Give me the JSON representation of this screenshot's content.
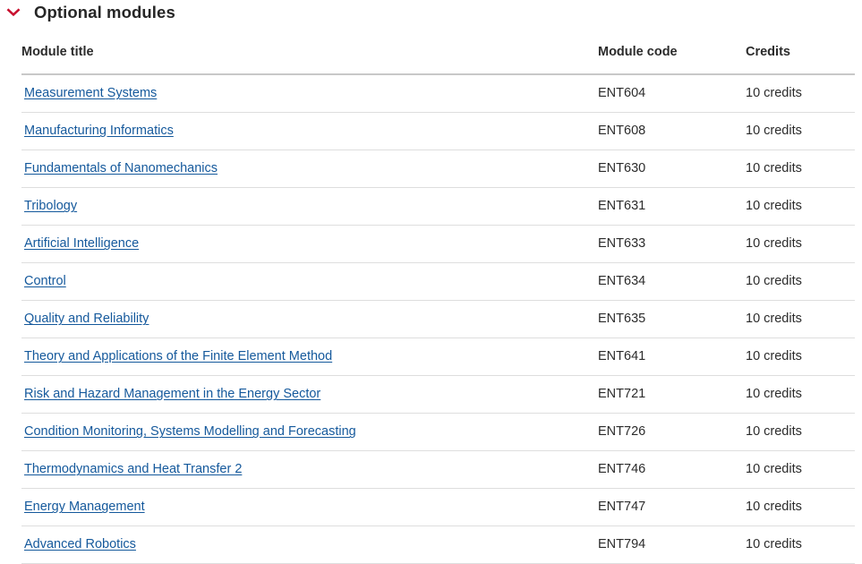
{
  "section": {
    "title": "Optional modules",
    "toggle_icon": "chevron-down-icon",
    "expanded": true,
    "accent_color": "#c8102e"
  },
  "table": {
    "columns": [
      {
        "key": "title",
        "label": "Module title"
      },
      {
        "key": "code",
        "label": "Module code"
      },
      {
        "key": "credits",
        "label": "Credits"
      }
    ],
    "link_color": "#15599c",
    "rows": [
      {
        "title": "Measurement Systems",
        "code": "ENT604",
        "credits": "10 credits"
      },
      {
        "title": "Manufacturing Informatics",
        "code": "ENT608",
        "credits": "10 credits"
      },
      {
        "title": "Fundamentals of Nanomechanics",
        "code": "ENT630",
        "credits": "10 credits"
      },
      {
        "title": "Tribology",
        "code": "ENT631",
        "credits": "10 credits"
      },
      {
        "title": "Artificial Intelligence",
        "code": "ENT633",
        "credits": "10 credits"
      },
      {
        "title": "Control",
        "code": "ENT634",
        "credits": "10 credits"
      },
      {
        "title": "Quality and Reliability",
        "code": "ENT635",
        "credits": "10 credits"
      },
      {
        "title": "Theory and Applications of the Finite Element Method",
        "code": "ENT641",
        "credits": "10 credits"
      },
      {
        "title": "Risk and Hazard Management in the Energy Sector",
        "code": "ENT721",
        "credits": "10 credits"
      },
      {
        "title": "Condition Monitoring, Systems Modelling and Forecasting",
        "code": "ENT726",
        "credits": "10 credits"
      },
      {
        "title": "Thermodynamics and Heat Transfer 2",
        "code": "ENT746",
        "credits": "10 credits"
      },
      {
        "title": "Energy Management",
        "code": "ENT747",
        "credits": "10 credits"
      },
      {
        "title": "Advanced Robotics",
        "code": "ENT794",
        "credits": "10 credits"
      }
    ]
  }
}
